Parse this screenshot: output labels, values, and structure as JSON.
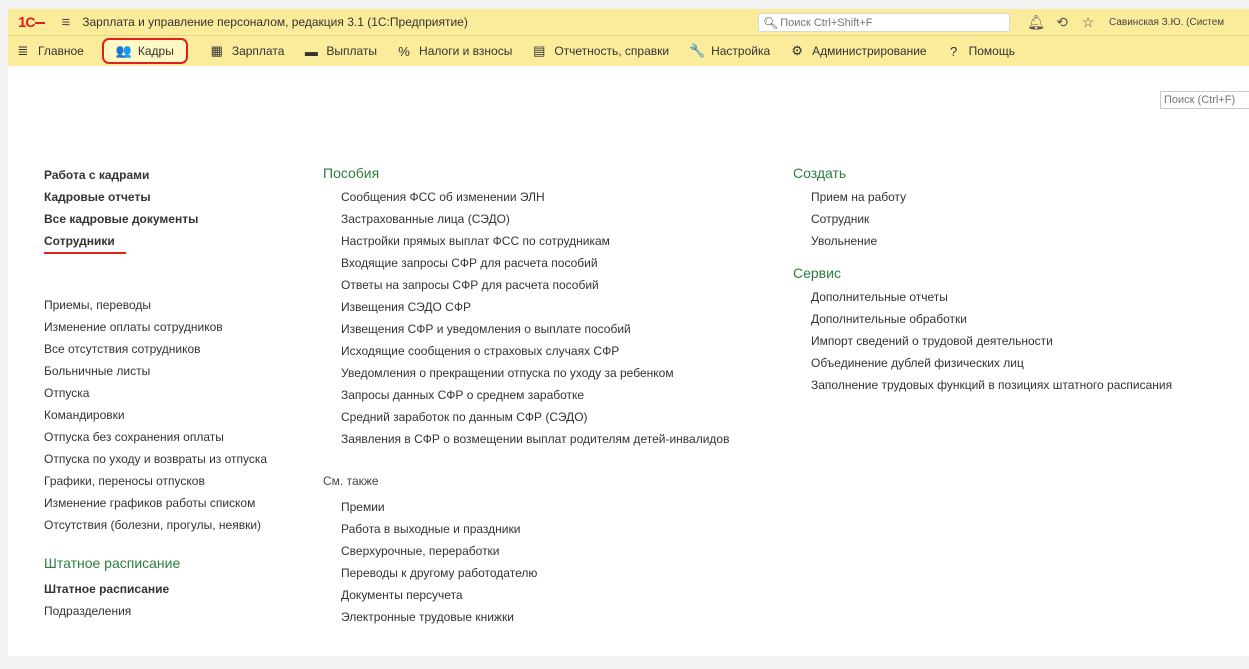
{
  "window": {
    "title": "Зарплата и управление персоналом, редакция 3.1  (1С:Предприятие)",
    "search_placeholder": "Поиск Ctrl+Shift+F",
    "user": "Савинская З.Ю. (Систем"
  },
  "menu": [
    {
      "label": "Главное",
      "icon": "≣",
      "active": false
    },
    {
      "label": "Кадры",
      "icon": "👥",
      "active": true
    },
    {
      "label": "Зарплата",
      "icon": "▦",
      "active": false
    },
    {
      "label": "Выплаты",
      "icon": "▬",
      "active": false
    },
    {
      "label": "Налоги и взносы",
      "icon": "%",
      "active": false
    },
    {
      "label": "Отчетность, справки",
      "icon": "▤",
      "active": false
    },
    {
      "label": "Настройка",
      "icon": "🔧",
      "active": false
    },
    {
      "label": "Администрирование",
      "icon": "⚙",
      "active": false
    },
    {
      "label": "Помощь",
      "icon": "?",
      "active": false
    }
  ],
  "page_search_placeholder": "Поиск (Ctrl+F)",
  "left": {
    "main_links": [
      "Работа с кадрами",
      "Кадровые отчеты",
      "Все кадровые документы",
      "Сотрудники"
    ],
    "links": [
      "Приемы, переводы",
      "Изменение оплаты сотрудников",
      "Все отсутствия сотрудников",
      "Больничные листы",
      "Отпуска",
      "Командировки",
      "Отпуска без сохранения оплаты",
      "Отпуска по уходу и возвраты из отпуска",
      "Графики, переносы отпусков",
      "Изменение графиков работы списком",
      "Отсутствия (болезни, прогулы, неявки)"
    ],
    "staff_heading": "Штатное расписание",
    "staff_main": "Штатное расписание",
    "staff_links": [
      "Подразделения"
    ]
  },
  "middle": {
    "heading": "Пособия",
    "links": [
      "Сообщения ФСС об изменении ЭЛН",
      "Застрахованные лица (СЭДО)",
      "Настройки прямых выплат ФСС по сотрудникам",
      "Входящие запросы СФР для расчета пособий",
      "Ответы на запросы СФР для расчета пособий",
      "Извещения СЭДО СФР",
      "Извещения СФР и уведомления о выплате пособий",
      "Исходящие сообщения о страховых случаях СФР",
      "Уведомления о прекращении отпуска по уходу за ребенком",
      "Запросы данных СФР о среднем заработке",
      "Средний заработок по данным СФР (СЭДО)",
      "Заявления в СФР о возмещении выплат родителям детей-инвалидов"
    ],
    "see_also": "См. также",
    "see_links": [
      "Премии",
      "Работа в выходные и праздники",
      "Сверхурочные, переработки",
      "Переводы к другому работодателю",
      "Документы персучета",
      "Электронные трудовые книжки"
    ]
  },
  "right": {
    "create_heading": "Создать",
    "create_links": [
      "Прием на работу",
      "Сотрудник",
      "Увольнение"
    ],
    "service_heading": "Сервис",
    "service_links": [
      "Дополнительные отчеты",
      "Дополнительные обработки",
      "Импорт сведений о трудовой деятельности",
      "Объединение дублей физических лиц",
      "Заполнение трудовых функций в позициях штатного расписания"
    ]
  }
}
